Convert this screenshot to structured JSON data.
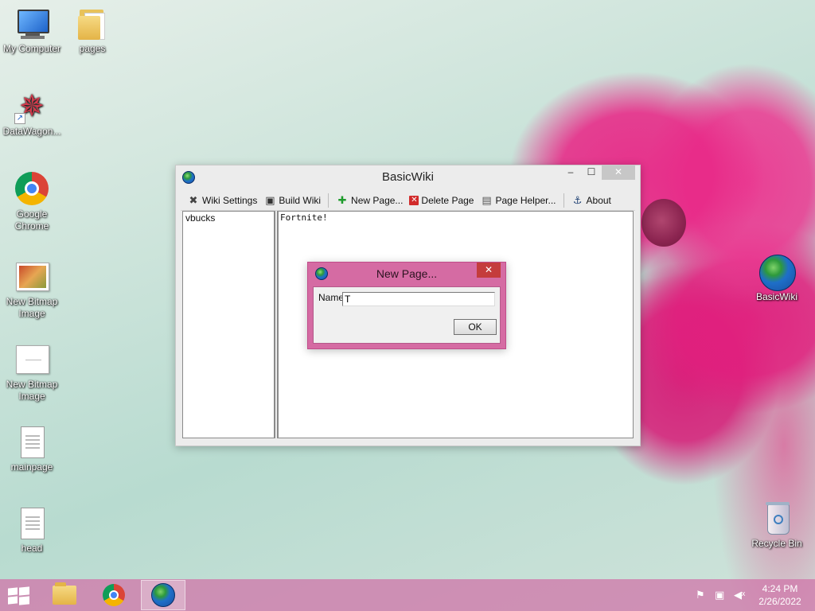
{
  "desktop": {
    "icons": [
      {
        "label": "My Computer"
      },
      {
        "label": "pages"
      },
      {
        "label": "DataWagon..."
      },
      {
        "label": "Google Chrome"
      },
      {
        "label": "New Bitmap Image"
      },
      {
        "label": "New Bitmap Image"
      },
      {
        "label": "mainpage"
      },
      {
        "label": "head"
      },
      {
        "label": "BasicWiki"
      },
      {
        "label": "Recycle Bin"
      }
    ]
  },
  "main_window": {
    "title": "BasicWiki",
    "minimize": "–",
    "maximize": "☐",
    "close": "✕",
    "toolbar": {
      "wiki_settings": "Wiki Settings",
      "build_wiki": "Build Wiki",
      "new_page": "New Page...",
      "delete_page": "Delete Page",
      "page_helper": "Page Helper...",
      "about": "About"
    },
    "pages": [
      "vbucks"
    ],
    "editor_text": "Fortnite!"
  },
  "dialog": {
    "title": "New Page...",
    "close": "✕",
    "name_label": "Name",
    "name_value": "T",
    "ok_label": "OK"
  },
  "taskbar": {
    "clock_time": "4:24 PM",
    "clock_date": "2/26/2022"
  },
  "colors": {
    "taskbar": "#d078aa",
    "dialog_frame": "#d56ba3",
    "close_button": "#c43c3c"
  },
  "icons": [
    "computer-icon",
    "folder-icon",
    "datawagon-icon",
    "chrome-icon",
    "bitmap-icon",
    "document-icon",
    "globe-icon",
    "recycle-bin-icon",
    "wrench-icon",
    "save-icon",
    "plus-icon",
    "delete-icon",
    "page-helper-icon",
    "about-icon",
    "start-icon",
    "flag-icon",
    "network-icon",
    "volume-muted-icon"
  ]
}
